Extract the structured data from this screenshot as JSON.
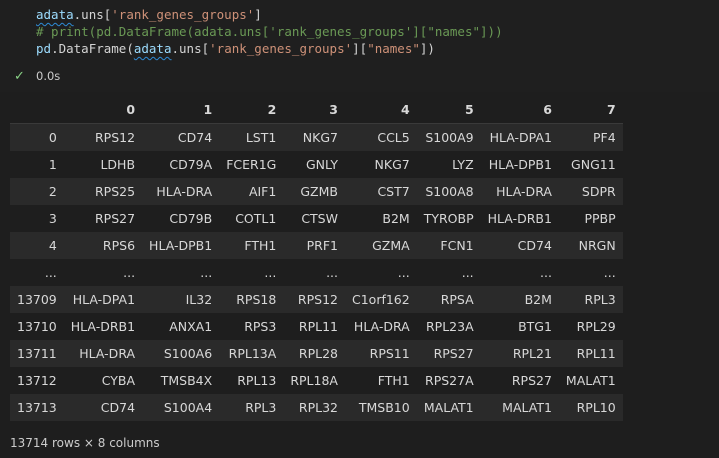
{
  "code": {
    "line1": {
      "var": "adata",
      "mid": ".uns[",
      "str": "'rank_genes_groups'",
      "end": "]"
    },
    "line2": {
      "text": "# print(pd.DataFrame(adata.uns['rank_genes_groups'][\"names\"]))"
    },
    "line3": {
      "pd": "pd",
      "dot": ".DataFrame(",
      "var": "adata",
      "mid": ".uns[",
      "str1": "'rank_genes_groups'",
      "mid2": "][",
      "str2": "\"names\"",
      "end": "])"
    }
  },
  "execution": {
    "status": "success",
    "time": "0.0s"
  },
  "table": {
    "columns": [
      "",
      "0",
      "1",
      "2",
      "3",
      "4",
      "5",
      "6",
      "7"
    ],
    "rows": [
      {
        "index": "0",
        "cells": [
          "RPS12",
          "CD74",
          "LST1",
          "NKG7",
          "CCL5",
          "S100A9",
          "HLA-DPA1",
          "PF4"
        ]
      },
      {
        "index": "1",
        "cells": [
          "LDHB",
          "CD79A",
          "FCER1G",
          "GNLY",
          "NKG7",
          "LYZ",
          "HLA-DPB1",
          "GNG11"
        ]
      },
      {
        "index": "2",
        "cells": [
          "RPS25",
          "HLA-DRA",
          "AIF1",
          "GZMB",
          "CST7",
          "S100A8",
          "HLA-DRA",
          "SDPR"
        ]
      },
      {
        "index": "3",
        "cells": [
          "RPS27",
          "CD79B",
          "COTL1",
          "CTSW",
          "B2M",
          "TYROBP",
          "HLA-DRB1",
          "PPBP"
        ]
      },
      {
        "index": "4",
        "cells": [
          "RPS6",
          "HLA-DPB1",
          "FTH1",
          "PRF1",
          "GZMA",
          "FCN1",
          "CD74",
          "NRGN"
        ]
      },
      {
        "index": "...",
        "cells": [
          "...",
          "...",
          "...",
          "...",
          "...",
          "...",
          "...",
          "..."
        ]
      },
      {
        "index": "13709",
        "cells": [
          "HLA-DPA1",
          "IL32",
          "RPS18",
          "RPS12",
          "C1orf162",
          "RPSA",
          "B2M",
          "RPL3"
        ]
      },
      {
        "index": "13710",
        "cells": [
          "HLA-DRB1",
          "ANXA1",
          "RPS3",
          "RPL11",
          "HLA-DRA",
          "RPL23A",
          "BTG1",
          "RPL29"
        ]
      },
      {
        "index": "13711",
        "cells": [
          "HLA-DRA",
          "S100A6",
          "RPL13A",
          "RPL28",
          "RPS11",
          "RPS27",
          "RPL21",
          "RPL11"
        ]
      },
      {
        "index": "13712",
        "cells": [
          "CYBA",
          "TMSB4X",
          "RPL13",
          "RPL18A",
          "FTH1",
          "RPS27A",
          "RPS27",
          "MALAT1"
        ]
      },
      {
        "index": "13713",
        "cells": [
          "CD74",
          "S100A4",
          "RPL3",
          "RPL32",
          "TMSB10",
          "MALAT1",
          "MALAT1",
          "RPL10"
        ]
      }
    ]
  },
  "footer": {
    "summary": "13714 rows × 8 columns"
  }
}
